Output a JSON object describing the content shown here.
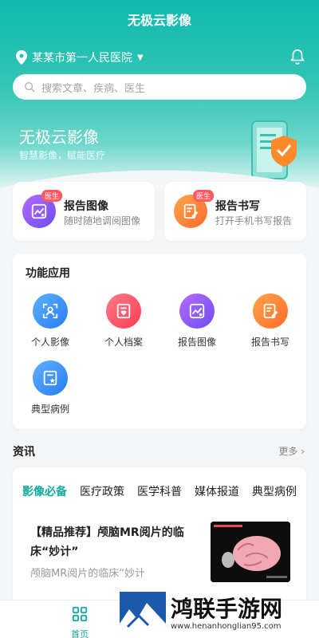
{
  "header": {
    "app_title": "无极云影像",
    "location": "某某市第一人民医院",
    "search_placeholder": "搜索文章、疾病、医生"
  },
  "banner": {
    "title": "无极云影像",
    "subtitle": "智慧影像，赋能医疗"
  },
  "quick_cards": [
    {
      "title": "报告图像",
      "subtitle": "随时随地调阅图像",
      "badge": "医生",
      "icon": "image-chart-icon"
    },
    {
      "title": "报告书写",
      "subtitle": "打开手机书写报告",
      "badge": "医生",
      "icon": "edit-report-icon"
    }
  ],
  "functions": {
    "title": "功能应用",
    "items": [
      {
        "label": "个人影像",
        "icon": "person-scan-icon",
        "color": "#3a95f7"
      },
      {
        "label": "个人档案",
        "icon": "heart-file-icon",
        "color": "#ff4d63"
      },
      {
        "label": "报告图像",
        "icon": "image-chart-icon",
        "color": "#8a5af4"
      },
      {
        "label": "报告书写",
        "icon": "edit-report-icon",
        "color": "#ff7a33"
      },
      {
        "label": "典型病例",
        "icon": "star-file-icon",
        "color": "#3a95f7"
      }
    ]
  },
  "news": {
    "title": "资讯",
    "more": "更多",
    "tabs": [
      "影像必备",
      "医疗政策",
      "医学科普",
      "媒体报道",
      "典型病例"
    ],
    "active_tab": 0,
    "article": {
      "title": "【精品推荐】颅脑MR阅片的临床“妙计”",
      "summary": "颅脑MR阅片的临床“妙计"
    }
  },
  "bottom_nav": {
    "home": "首页"
  },
  "watermark": {
    "text": "鸿联手游网",
    "url": "www.henanhonglian95.com"
  },
  "colors": {
    "accent": "#11a99f",
    "header_top": "#0fb9ac",
    "badge": "#ff5a5f"
  }
}
